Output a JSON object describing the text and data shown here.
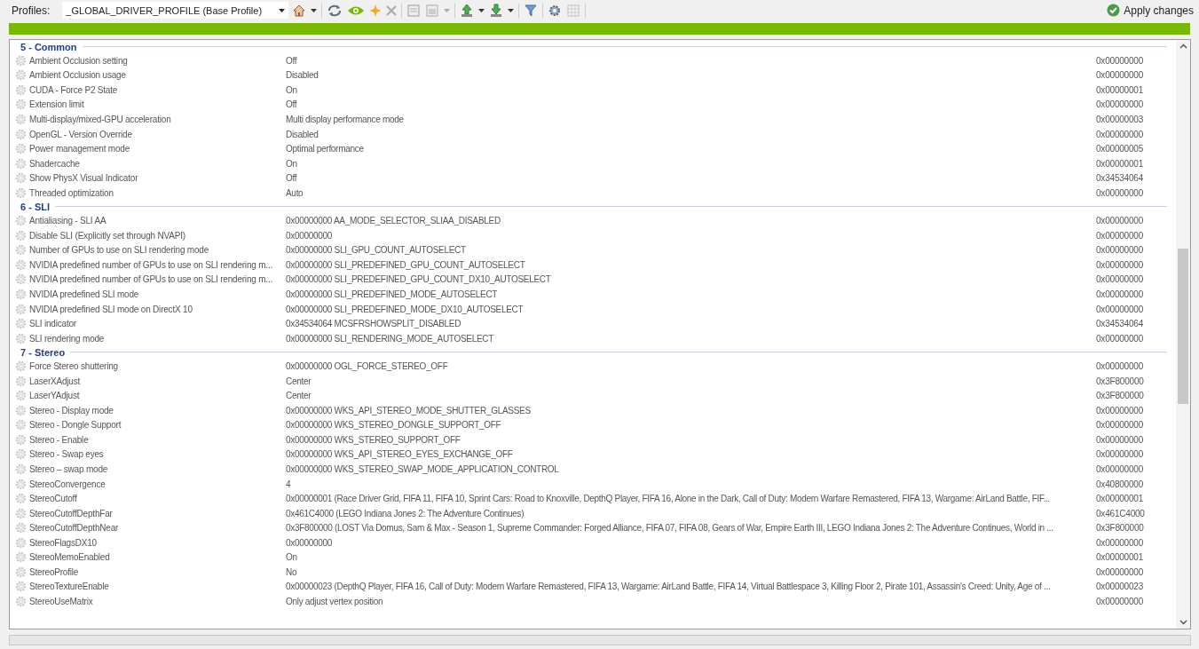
{
  "toolbar": {
    "profiles_label": "Profiles:",
    "profile": "_GLOBAL_DRIVER_PROFILE (Base Profile)",
    "apply": "Apply changes"
  },
  "groups": [
    {
      "title": "5 - Common",
      "rows": [
        {
          "name": "Ambient Occlusion setting",
          "value": "Off",
          "hex": "0x00000000"
        },
        {
          "name": "Ambient Occlusion usage",
          "value": "Disabled",
          "hex": "0x00000000"
        },
        {
          "name": "CUDA - Force P2 State",
          "value": "On",
          "hex": "0x00000001"
        },
        {
          "name": "Extension limit",
          "value": "Off",
          "hex": "0x00000000"
        },
        {
          "name": "Multi-display/mixed-GPU acceleration",
          "value": "Multi display performance mode",
          "hex": "0x00000003"
        },
        {
          "name": "OpenGL - Version Override",
          "value": "Disabled",
          "hex": "0x00000000"
        },
        {
          "name": "Power management mode",
          "value": "Optimal performance",
          "hex": "0x00000005"
        },
        {
          "name": "Shadercache",
          "value": "On",
          "hex": "0x00000001"
        },
        {
          "name": "Show PhysX Visual Indicator",
          "value": "Off",
          "hex": "0x34534064"
        },
        {
          "name": "Threaded optimization",
          "value": "Auto",
          "hex": "0x00000000"
        }
      ]
    },
    {
      "title": "6 - SLI",
      "rows": [
        {
          "name": "Antialiasing - SLI AA",
          "value": "0x00000000 AA_MODE_SELECTOR_SLIAA_DISABLED",
          "hex": "0x00000000"
        },
        {
          "name": "Disable SLI (Explicitly set through NVAPI)",
          "value": "0x00000000",
          "hex": "0x00000000"
        },
        {
          "name": "Number of GPUs to use on SLI rendering mode",
          "value": "0x00000000 SLI_GPU_COUNT_AUTOSELECT",
          "hex": "0x00000000"
        },
        {
          "name": "NVIDIA predefined number of GPUs to use on SLI rendering m...",
          "value": "0x00000000 SLI_PREDEFINED_GPU_COUNT_AUTOSELECT",
          "hex": "0x00000000"
        },
        {
          "name": "NVIDIA predefined number of GPUs to use on SLI rendering m...",
          "value": "0x00000000 SLI_PREDEFINED_GPU_COUNT_DX10_AUTOSELECT",
          "hex": "0x00000000"
        },
        {
          "name": "NVIDIA predefined SLI mode",
          "value": "0x00000000 SLI_PREDEFINED_MODE_AUTOSELECT",
          "hex": "0x00000000"
        },
        {
          "name": "NVIDIA predefined SLI mode on DirectX 10",
          "value": "0x00000000 SLI_PREDEFINED_MODE_DX10_AUTOSELECT",
          "hex": "0x00000000"
        },
        {
          "name": "SLI indicator",
          "value": "0x34534064 MCSFRSHOWSPLIT_DISABLED",
          "hex": "0x34534064"
        },
        {
          "name": "SLI rendering mode",
          "value": "0x00000000 SLI_RENDERING_MODE_AUTOSELECT",
          "hex": "0x00000000"
        }
      ]
    },
    {
      "title": "7 - Stereo",
      "rows": [
        {
          "name": "Force Stereo shuttering",
          "value": "0x00000000 OGL_FORCE_STEREO_OFF",
          "hex": "0x00000000"
        },
        {
          "name": "LaserXAdjust",
          "value": "Center",
          "hex": "0x3F800000"
        },
        {
          "name": "LaserYAdjust",
          "value": "Center",
          "hex": "0x3F800000"
        },
        {
          "name": "Stereo - Display mode",
          "value": "0x00000000 WKS_API_STEREO_MODE_SHUTTER_GLASSES",
          "hex": "0x00000000"
        },
        {
          "name": "Stereo - Dongle Support",
          "value": "0x00000000 WKS_STEREO_DONGLE_SUPPORT_OFF",
          "hex": "0x00000000"
        },
        {
          "name": "Stereo - Enable",
          "value": "0x00000000 WKS_STEREO_SUPPORT_OFF",
          "hex": "0x00000000"
        },
        {
          "name": "Stereo - Swap eyes",
          "value": "0x00000000 WKS_API_STEREO_EYES_EXCHANGE_OFF",
          "hex": "0x00000000"
        },
        {
          "name": "Stereo – swap mode",
          "value": "0x00000000 WKS_STEREO_SWAP_MODE_APPLICATION_CONTROL",
          "hex": "0x00000000"
        },
        {
          "name": "StereoConvergence",
          "value": "4",
          "hex": "0x40800000"
        },
        {
          "name": "StereoCutoff",
          "value": "0x00000001 (Race Driver Grid, FIFA 11, FIFA 10, Sprint Cars: Road to Knoxville, DepthQ Player, FIFA 16, Alone in the Dark, Call of Duty: Modern Warfare Remastered, FIFA 13, Wargame: AirLand Battle, FIF...",
          "hex": "0x00000001"
        },
        {
          "name": "StereoCutoffDepthFar",
          "value": "0x461C4000 (LEGO Indiana Jones 2: The Adventure Continues)",
          "hex": "0x461C4000"
        },
        {
          "name": "StereoCutoffDepthNear",
          "value": "0x3F800000 (LOST Via Domus, Sam & Max - Season 1, Supreme Commander: Forged Alliance, FIFA 07, FIFA 08, Gears of War, Empire Earth III, LEGO Indiana Jones 2: The Adventure Continues, World in ...",
          "hex": "0x3F800000"
        },
        {
          "name": "StereoFlagsDX10",
          "value": "0x00000000",
          "hex": "0x00000000"
        },
        {
          "name": "StereoMemoEnabled",
          "value": "On",
          "hex": "0x00000001"
        },
        {
          "name": "StereoProfile",
          "value": "No",
          "hex": "0x00000000"
        },
        {
          "name": "StereoTextureEnable",
          "value": "0x00000023 (DepthQ Player, FIFA 16, Call of Duty: Modern Warfare Remastered, FIFA 13, Wargame: AirLand Battle, FIFA 14, Virtual Battlespace 3, Killing Floor 2, Pirate 101, Assassin's Creed: Unity, Age of ...",
          "hex": "0x00000023"
        },
        {
          "name": "StereoUseMatrix",
          "value": "Only adjust vertex position",
          "hex": "0x00000000"
        }
      ]
    }
  ]
}
